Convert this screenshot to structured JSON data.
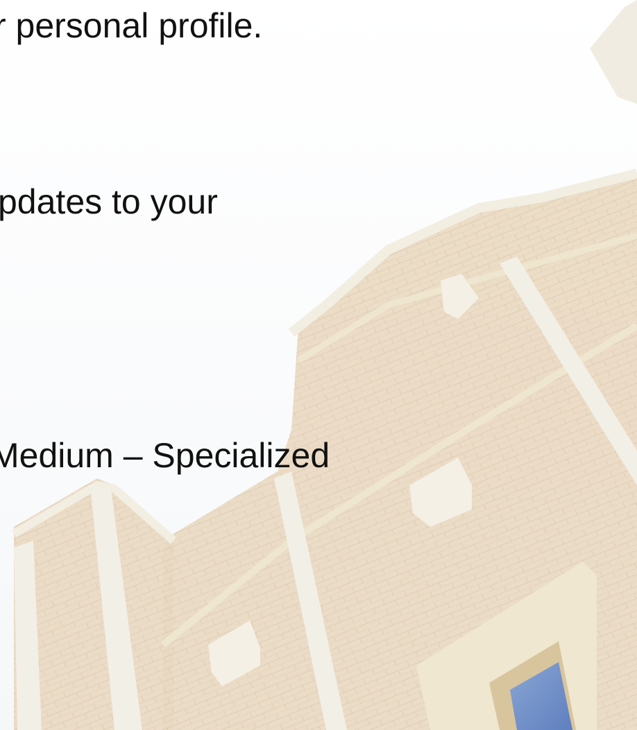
{
  "slide": {
    "lines": [
      "r personal profile.",
      "pdates to your",
      "Medium – Specialized"
    ]
  },
  "background": {
    "subject": "brick-building-facade-photo",
    "colors": {
      "sky": "#fbfcfd",
      "brick": "#e8d6be",
      "stone_trim": "#f1ece0",
      "window_glass": "#6f8fc8"
    }
  }
}
